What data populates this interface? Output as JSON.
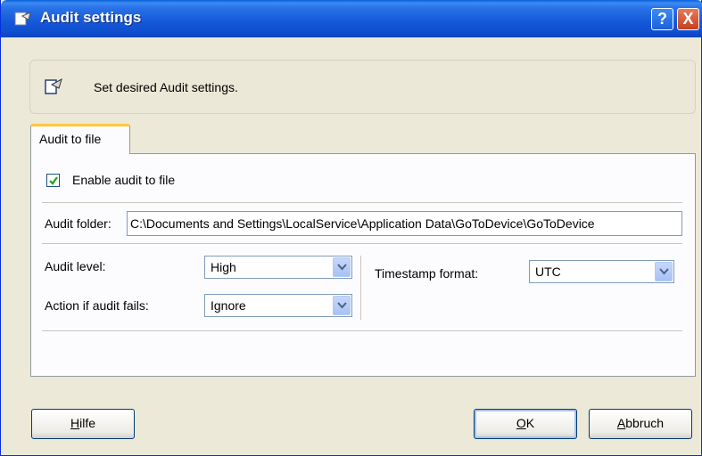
{
  "window": {
    "title": "Audit settings",
    "help_button": "?",
    "close_button": "X"
  },
  "header": {
    "text": "Set desired Audit settings."
  },
  "tabs": [
    {
      "label": "Audit to file",
      "active": true
    }
  ],
  "form": {
    "enable_audit": {
      "label": "Enable audit to file",
      "checked": true
    },
    "audit_folder": {
      "label": "Audit folder:",
      "value": "C:\\Documents and Settings\\LocalService\\Application Data\\GoToDevice\\GoToDevice"
    },
    "audit_level": {
      "label": "Audit level:",
      "value": "High"
    },
    "action_if_fails": {
      "label": "Action if audit fails:",
      "value": "Ignore"
    },
    "timestamp_format": {
      "label": "Timestamp format:",
      "value": "UTC"
    }
  },
  "buttons": {
    "help": {
      "accel": "H",
      "rest": "ilfe"
    },
    "ok": {
      "accel": "O",
      "rest": "K"
    },
    "cancel": {
      "accel": "A",
      "rest": "bbruch"
    }
  },
  "colors": {
    "titlebar": "#1457d8",
    "face": "#ece9d8",
    "tab_highlight": "#ffc83c",
    "checkmark": "#21a121",
    "close": "#c6401f"
  }
}
